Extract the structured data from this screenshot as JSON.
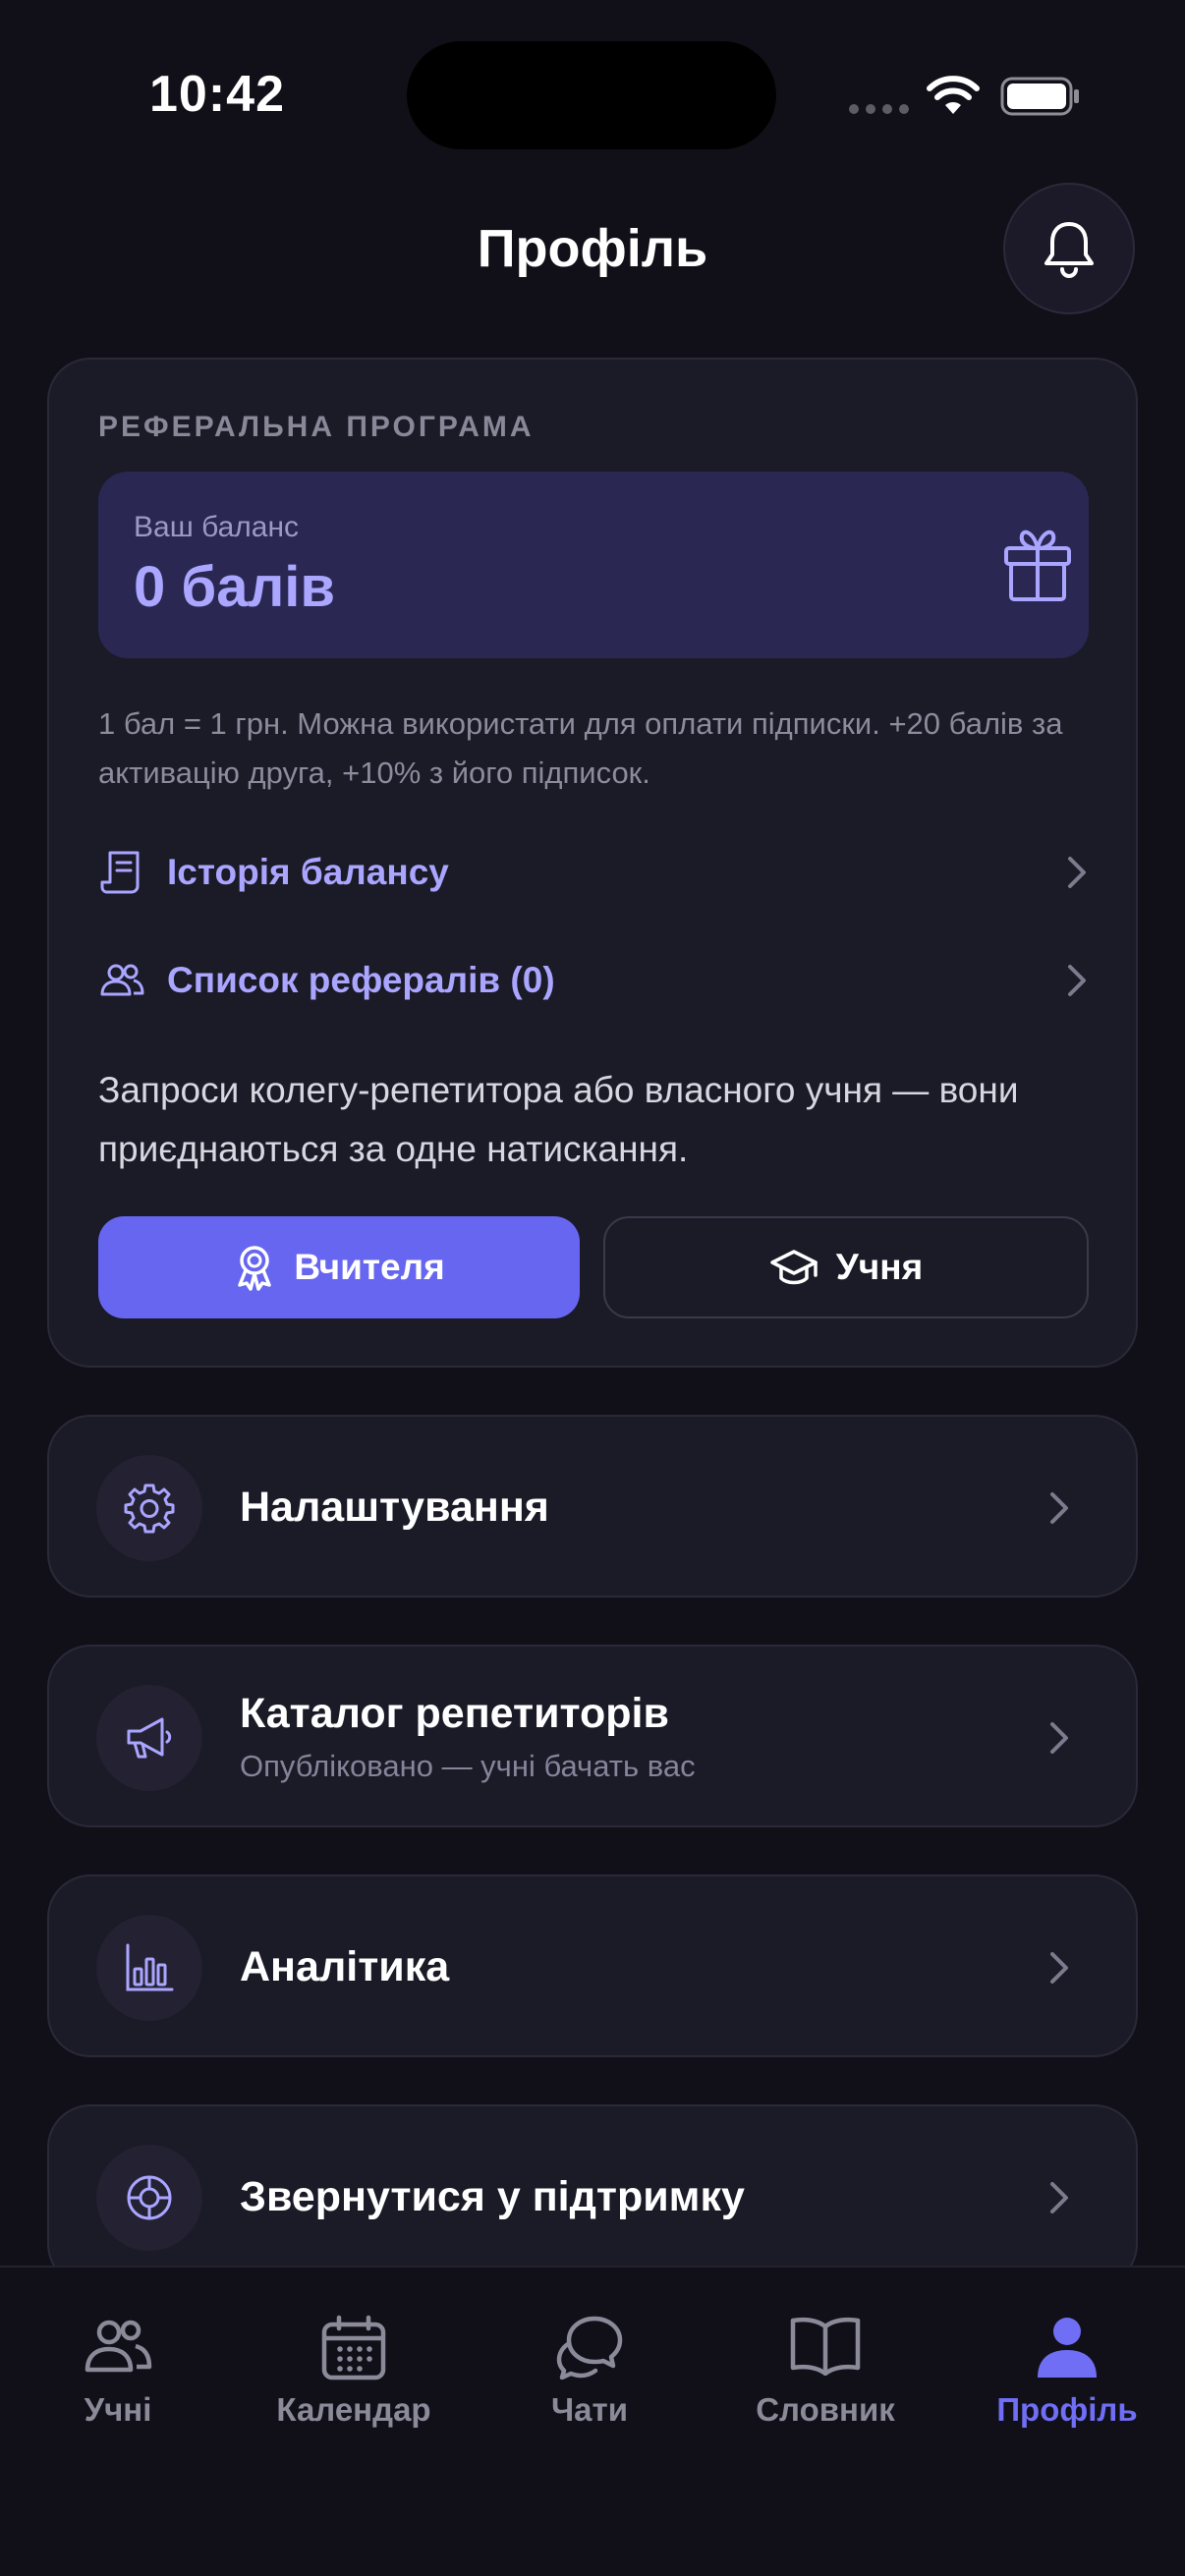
{
  "status_bar": {
    "time": "10:42"
  },
  "header": {
    "title": "Профіль"
  },
  "referral": {
    "section_label": "РЕФЕРАЛЬНА ПРОГРАМА",
    "balance_caption": "Ваш баланс",
    "balance_value": "0 балів",
    "description": "1 бал = 1 грн. Можна використати для оплати підписки. +20 балів за активацію друга, +10% з його підписок.",
    "history_link": "Історія балансу",
    "referrals_link": "Список рефералів (0)",
    "invite_text": "Запроси колегу-репетитора або власного учня — вони приєднаються за одне натискання.",
    "btn_teachers": "Вчителя",
    "btn_students": "Учня"
  },
  "menu": {
    "settings": {
      "title": "Налаштування"
    },
    "catalog": {
      "title": "Каталог репетиторів",
      "subtitle": "Опубліковано — учні бачать вас"
    },
    "analytics": {
      "title": "Аналітика"
    },
    "support": {
      "title": "Звернутися у підтримку"
    }
  },
  "tabs": [
    {
      "label": "Учні"
    },
    {
      "label": "Календар"
    },
    {
      "label": "Чати"
    },
    {
      "label": "Словник"
    },
    {
      "label": "Профіль"
    }
  ],
  "colors": {
    "accent": "#6766f0",
    "accent_text": "#aaa5ff",
    "background": "#111019",
    "card": "#1b1a27"
  }
}
